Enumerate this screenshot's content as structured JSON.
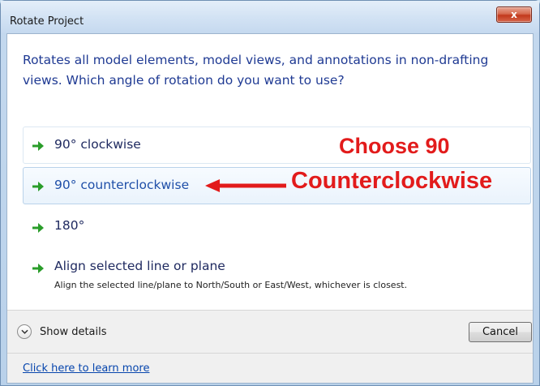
{
  "window": {
    "title": "Rotate Project",
    "close_glyph": "x"
  },
  "instruction": "Rotates all model elements, model views, and annotations in non-drafting views.  Which angle of rotation do you want to use?",
  "commands": [
    {
      "label": "90° clockwise",
      "sublabel": ""
    },
    {
      "label": "90° counterclockwise",
      "sublabel": ""
    },
    {
      "label": "180°",
      "sublabel": ""
    },
    {
      "label": "Align selected line or plane",
      "sublabel": "Align the selected line/plane to North/South or East/West, whichever is closest."
    }
  ],
  "annotation": {
    "line1": "Choose 90",
    "line2": "Counterclockwise",
    "color": "#e21b1b"
  },
  "footer": {
    "details_label": "Show details",
    "cancel_label": "Cancel",
    "learn_more": "Click here to learn more"
  },
  "icons": {
    "command": "green-arrow-icon",
    "details": "chevron-down-icon"
  }
}
